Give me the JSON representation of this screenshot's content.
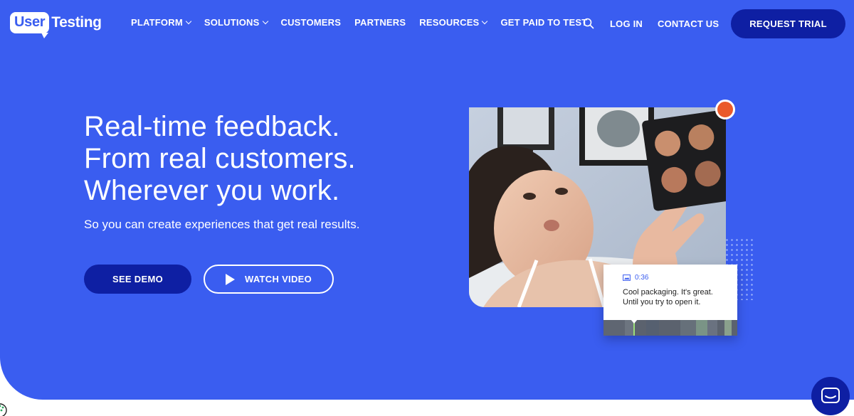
{
  "brand": {
    "logo_bubble": "User",
    "logo_text": "Testing"
  },
  "nav": {
    "items": [
      {
        "label": "PLATFORM",
        "dropdown": true
      },
      {
        "label": "SOLUTIONS",
        "dropdown": true
      },
      {
        "label": "CUSTOMERS",
        "dropdown": false
      },
      {
        "label": "PARTNERS",
        "dropdown": false
      },
      {
        "label": "RESOURCES",
        "dropdown": true
      },
      {
        "label": "GET PAID TO TEST",
        "dropdown": false
      }
    ],
    "search_icon": "search-icon",
    "login": "LOG IN",
    "contact": "CONTACT US",
    "trial_button": "REQUEST TRIAL"
  },
  "hero": {
    "headline_lines": [
      "Real-time feedback.",
      "From real customers.",
      "Wherever you work."
    ],
    "subhead": "So you can create experiences that get real results.",
    "demo_button": "SEE DEMO",
    "video_button": "WATCH VIDEO"
  },
  "media": {
    "comment_time": "0:36",
    "comment_text": "Cool packaging. It's great. Until you try to open it."
  },
  "colors": {
    "hero_background": "#3a5df0",
    "dark_button": "#0e1fa3",
    "record_dot": "#ea5a2a",
    "white": "#ffffff"
  },
  "icons": {
    "chat": "chat-icon",
    "play": "play-icon",
    "record": "record-dot-icon"
  }
}
